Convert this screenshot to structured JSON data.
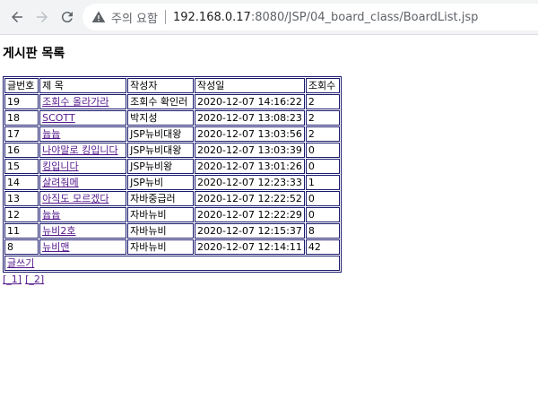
{
  "browser": {
    "security_label": "주의 요함",
    "url_host": "192.168.0.17",
    "url_path": ":8080/JSP/04_board_class/BoardList.jsp"
  },
  "page": {
    "title": "게시판 목록",
    "columns": [
      "글번호",
      "제 목",
      "작성자",
      "작성일",
      "조회수"
    ],
    "rows": [
      {
        "num": "19",
        "title": "조회수 올라가라",
        "author": "조회수 확인러",
        "date": "2020-12-07 14:16:22",
        "views": "2"
      },
      {
        "num": "18",
        "title": "SCOTT",
        "author": "박지성",
        "date": "2020-12-07 13:08:23",
        "views": "2"
      },
      {
        "num": "17",
        "title": "늅늅",
        "author": "JSP뉴비대왕",
        "date": "2020-12-07 13:03:56",
        "views": "2"
      },
      {
        "num": "16",
        "title": "나야말로 킹입니다",
        "author": "JSP뉴비대왕",
        "date": "2020-12-07 13:03:39",
        "views": "0"
      },
      {
        "num": "15",
        "title": "킹입니다",
        "author": "JSP뉴비왕",
        "date": "2020-12-07 13:01:26",
        "views": "0"
      },
      {
        "num": "14",
        "title": "살려줘메",
        "author": "JSP뉴비",
        "date": "2020-12-07 12:23:33",
        "views": "1"
      },
      {
        "num": "13",
        "title": "아직도 모르겠다",
        "author": "자바중급러",
        "date": "2020-12-07 12:22:52",
        "views": "0"
      },
      {
        "num": "12",
        "title": "늅늅",
        "author": "자바뉴비",
        "date": "2020-12-07 12:22:29",
        "views": "0"
      },
      {
        "num": "11",
        "title": "뉴비2호",
        "author": "자바뉴비",
        "date": "2020-12-07 12:15:37",
        "views": "8"
      },
      {
        "num": "8",
        "title": "뉴비맨",
        "author": "자바뉴비",
        "date": "2020-12-07 12:14:11",
        "views": "42"
      }
    ],
    "write_link": "글쓰기",
    "pages": [
      "[_1]",
      "[_2]"
    ]
  }
}
